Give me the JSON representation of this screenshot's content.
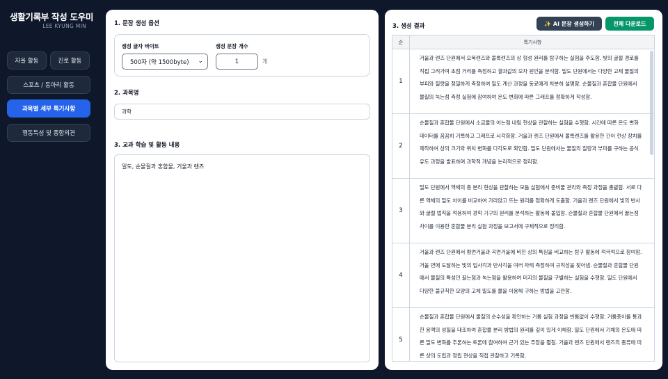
{
  "sidebar": {
    "app_title": "생활기록부 작성 도우미",
    "author": "LEE KYUNG MIN",
    "items": [
      {
        "label": "자율 활동"
      },
      {
        "label": "진로 활동"
      },
      {
        "label": "스포츠 / 동아리 활동"
      },
      {
        "label": "과목별 세부 특기사항"
      },
      {
        "label": "행동특성 및 종합의견"
      }
    ]
  },
  "left": {
    "section1_title": "1. 문장 생성 옵션",
    "byte_label": "생성 글자 바이트",
    "byte_value": "500자 (약 1500byte)",
    "count_label": "생성 문장 개수",
    "count_value": "1",
    "count_unit": "개",
    "section2_title": "2. 과목명",
    "subject_value": "과학",
    "section3_title": "3. 교과 학습 및 활동 내용",
    "activity_value": "밀도, 순물질과 혼합물, 거울과 렌즈"
  },
  "right": {
    "section_title": "3. 생성 결과",
    "ai_button": "✨ AI 문장 생성하기",
    "download_button": "전체 다운로드",
    "table": {
      "col_num": "순",
      "col_content": "특기사항",
      "rows": [
        {
          "num": "1",
          "text": "거울과 렌즈 단원에서 오목렌즈와 볼록렌즈의 상 형성 원리를 탐구하는 실험을 주도함. 빛의 굴절 경로를 직접 그려가며 초점 거리를 측정하고 결과값의 오차 원인을 분석함. 밀도 단원에서는 다양한 고체 물질의 부피와 질량을 정밀하게 측정하여 밀도 계산 과정을 동료에게 차분히 설명함. 순물질과 혼합물 단원에서 물질의 녹는점 측정 실험에 참여하여 온도 변화에 따른 그래프를 정확하게 작성함."
        },
        {
          "num": "2",
          "text": "순물질과 혼합물 단원에서 소금물의 어는점 내림 현상을 관찰하는 실험을 수행함. 시간에 따른 온도 변화 데이터를 꼼꼼히 기록하고 그래프로 시각화함. 거울과 렌즈 단원에서 볼록렌즈를 활용한 간이 현상 장치를 제작하여 상의 크기와 위치 변화를 다각도로 확인함. 밀도 단원에서는 물질의 질량과 부피를 구하는 공식 유도 과정을 발표하며 과학적 개념을 논리적으로 정리함."
        },
        {
          "num": "3",
          "text": "밀도 단원에서 액체의 층 분리 현상을 관찰하는 모둠 실험에서 준비물 관리와 측정 과정을 총괄함. 서로 다른 액체의 밀도 차이를 비교하여 가라앉고 뜨는 원리를 정확하게 도출함. 거울과 렌즈 단원에서 빛의 반사와 굴절 법칙을 적용하여 광학 기구의 원리를 분석하는 활동에 몰입함. 순물질과 혼합물 단원에서 끓는점 차이를 이용한 혼합물 분리 실험 과정을 보고서에 구체적으로 정리함."
        },
        {
          "num": "4",
          "text": "거울과 렌즈 단원에서 평면거울과 곡면거울에 비친 상의 특징을 비교하는 탐구 활동에 적극적으로 참여함. 거울 면에 도달하는 빛의 입사각과 반사각을 여러 차례 측정하여 규칙성을 찾아냄. 순물질과 혼합물 단원에서 물질의 특성인 끓는점과 녹는점을 활용하여 미지의 물질을 구별하는 실험을 수행함. 밀도 단원에서 다양한 불규칙한 모양의 고체 밀도를 물을 이용해 구하는 방법을 고안함."
        },
        {
          "num": "5",
          "text": "순물질과 혼합물 단원에서 물질의 순수성을 확인하는 거름 실험 과정을 빈틈없이 수행함. 거름종이를 통과한 용액의 성질을 대조하여 혼합물 분리 방법의 원리를 깊이 있게 이해함. 밀도 단원에서 기체의 온도에 따른 밀도 변화를 추론하는 토론에 참여하여 근거 있는 주장을 펼침. 거울과 렌즈 단원에서 렌즈의 종류에 따른 상의 도립과 정립 현상을 직접 관찰하고 기록함."
        }
      ]
    }
  },
  "colors": {
    "sidebar_bg": "#0f172a",
    "active": "#2563eb",
    "ai_button": "#334155",
    "download_button": "#059669"
  }
}
